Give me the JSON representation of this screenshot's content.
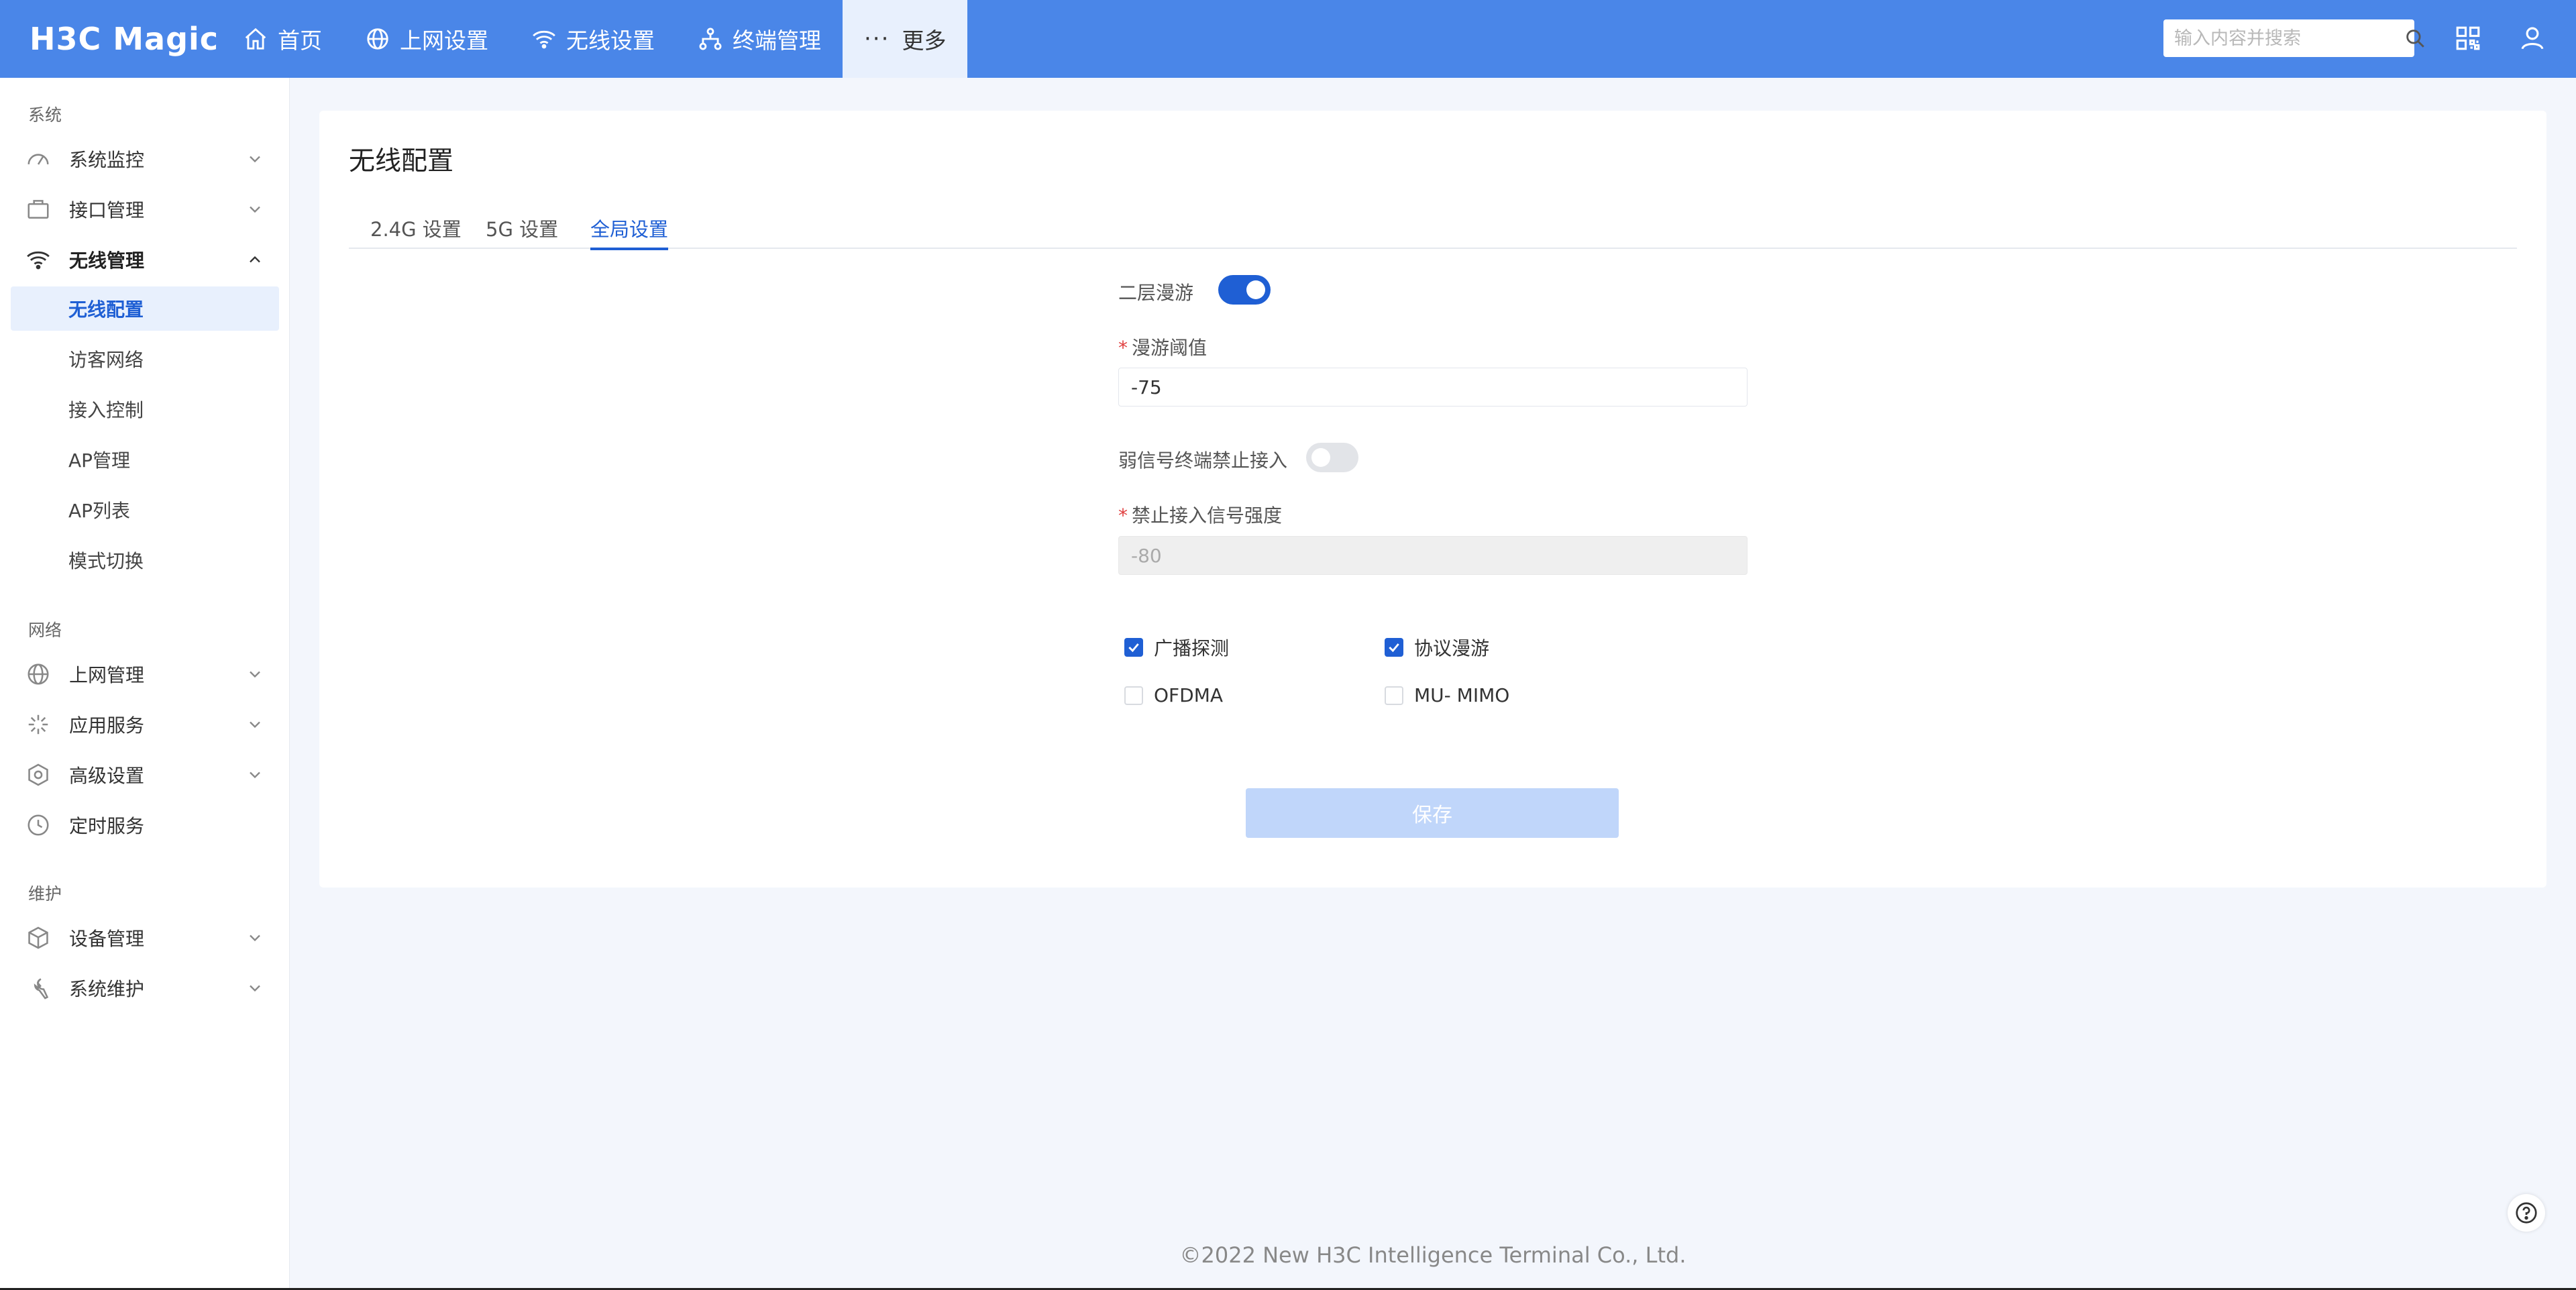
{
  "brand": {
    "logo_text": "H3C Magic"
  },
  "nav": {
    "items": [
      {
        "label": "首页",
        "icon": "home-icon"
      },
      {
        "label": "上网设置",
        "icon": "globe-icon"
      },
      {
        "label": "无线设置",
        "icon": "wifi-icon"
      },
      {
        "label": "终端管理",
        "icon": "network-icon"
      },
      {
        "label": "更多",
        "icon": "more-icon"
      }
    ]
  },
  "search": {
    "placeholder": "输入内容并搜索"
  },
  "sidebar": {
    "groups": [
      "系统",
      "网络",
      "维护"
    ],
    "items": [
      {
        "label": "系统监控"
      },
      {
        "label": "接口管理"
      },
      {
        "label": "无线管理"
      },
      {
        "label": "上网管理"
      },
      {
        "label": "应用服务"
      },
      {
        "label": "高级设置"
      },
      {
        "label": "定时服务"
      },
      {
        "label": "设备管理"
      },
      {
        "label": "系统维护"
      }
    ],
    "subitems": [
      {
        "label": "无线配置",
        "active": true
      },
      {
        "label": "访客网络"
      },
      {
        "label": "接入控制"
      },
      {
        "label": "AP管理"
      },
      {
        "label": "AP列表"
      },
      {
        "label": "模式切换"
      }
    ]
  },
  "main": {
    "title": "无线配置",
    "tabs": [
      {
        "label": "2.4G 设置"
      },
      {
        "label": "5G 设置"
      },
      {
        "label": "全局设置",
        "active": true
      }
    ],
    "form": {
      "layer2_roaming_label": "二层漫游",
      "layer2_roaming_on": true,
      "roaming_threshold_label": "漫游阈值",
      "roaming_threshold_value": "-75",
      "weak_signal_label": "弱信号终端禁止接入",
      "weak_signal_on": false,
      "deny_signal_label": "禁止接入信号强度",
      "deny_signal_placeholder": "-80",
      "checkboxes": [
        {
          "label": "广播探测",
          "checked": true
        },
        {
          "label": "协议漫游",
          "checked": true
        },
        {
          "label": "OFDMA",
          "checked": false
        },
        {
          "label": "MU- MIMO",
          "checked": false
        }
      ],
      "save_label": "保存"
    }
  },
  "footer": {
    "copyright": "©2022 New H3C Intelligence Terminal Co., Ltd."
  },
  "colors": {
    "accent": "#4a86e8",
    "primary": "#1f5fd4",
    "background": "#f3f6fc"
  }
}
